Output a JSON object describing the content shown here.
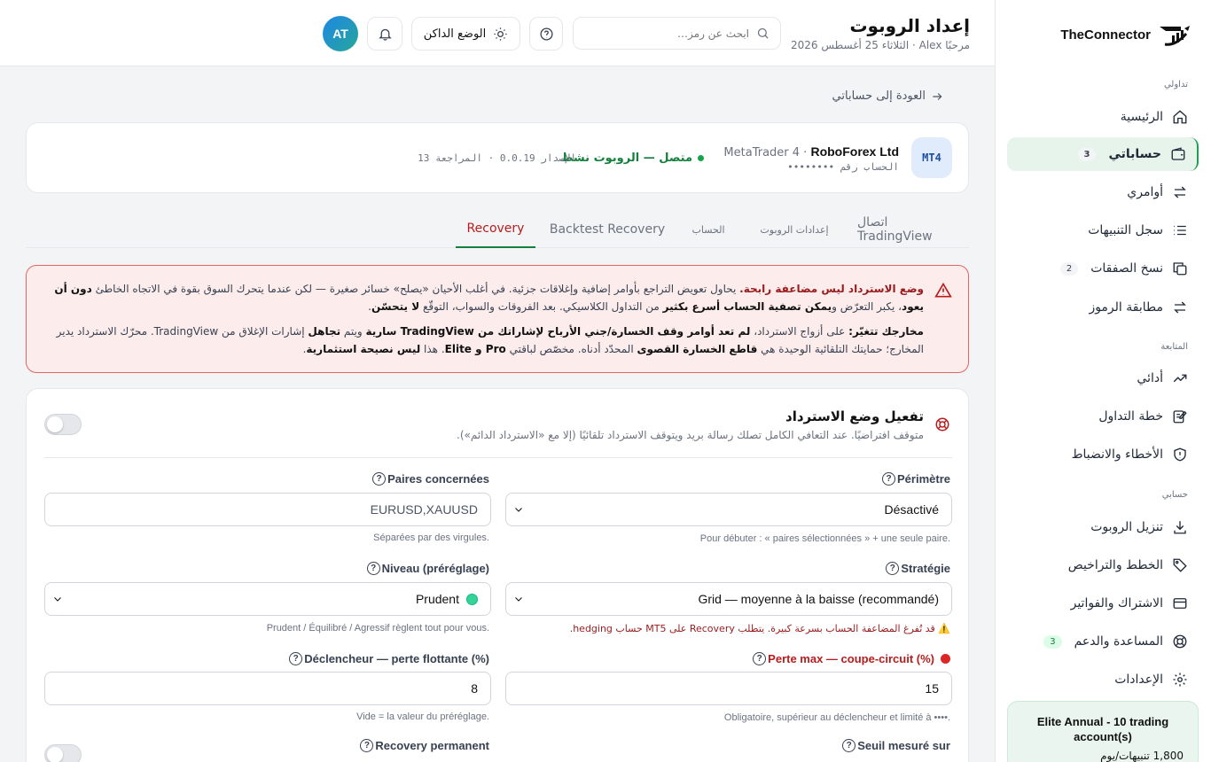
{
  "sidebar": {
    "brand": "TheConnector",
    "sections": {
      "trading": "تداولي",
      "tracking": "المتابعة",
      "account": "حسابي"
    },
    "items": [
      {
        "label": "الرئيسية",
        "badge": ""
      },
      {
        "label": "حساباتي",
        "badge": "3"
      },
      {
        "label": "أوامري",
        "badge": ""
      },
      {
        "label": "سجل التنبيهات",
        "badge": ""
      },
      {
        "label": "نسخ الصفقات",
        "badge": "2"
      },
      {
        "label": "مطابقة الرموز",
        "badge": ""
      },
      {
        "label": "أدائي",
        "badge": ""
      },
      {
        "label": "خطة التداول",
        "badge": ""
      },
      {
        "label": "الأخطاء والانضباط",
        "badge": ""
      },
      {
        "label": "تنزيل الروبوت",
        "badge": ""
      },
      {
        "label": "الخطط والتراخيص",
        "badge": ""
      },
      {
        "label": "الاشتراك والفواتير",
        "badge": ""
      },
      {
        "label": "المساعدة والدعم",
        "badge": "3"
      },
      {
        "label": "الإعدادات",
        "badge": ""
      }
    ],
    "plan": {
      "title": "Elite Annual - 10 trading account(s)",
      "sub": "1,800 تنبيهات/يوم"
    }
  },
  "header": {
    "title": "إعداد الروبوت",
    "subtitle": "مرحبًا Alex · الثلاثاء 25 أغسطس 2026",
    "search_placeholder": "ابحث عن رمز…",
    "dark_mode": "الوضع الداكن",
    "avatar": "AT"
  },
  "back_link": "العودة إلى حساباتي",
  "account": {
    "platform_badge": "MT4",
    "platform": "MetaTrader 4 ·",
    "broker": "RoboForex Ltd",
    "number": "الحساب رقم ••••••••",
    "status": "متصل — الروبوت نشط",
    "version": "الإصدار 0.0.19 · المراجعة 13"
  },
  "tabs": [
    "اتصال TradingView",
    "إعدادات الروبوت",
    "الحساب",
    "Backtest Recovery",
    "Recovery"
  ],
  "alert": {
    "p1_b1": "وضع الاسترداد ليس مضاعفة رابحة.",
    "p1_t1": " يحاول تعويض التراجع بأوامر إضافية وإغلاقات جزئية. في أغلب الأحيان «يصلح» خسائر صغيرة — لكن عندما يتحرك السوق بقوة في الاتجاه الخاطئ ",
    "p1_b2": "دون أن يعود",
    "p1_t2": "، يكبر التعرّض و",
    "p1_b3": "يمكن تصفية الحساب أسرع بكثير",
    "p1_t3": " من التداول الكلاسيكي. بعد الفروقات والسواب، التوقّع ",
    "p1_b4": "لا يتحسّن",
    "p1_t4": ".",
    "p2_b1": "مخارجك تتغيّر:",
    "p2_t1": " على أزواج الاسترداد، ",
    "p2_b2": "لم تعد أوامر وقف الخسارة/جني الأرباح لإشاراتك من TradingView سارية",
    "p2_t2": " ويتم ",
    "p2_b3": "تجاهل",
    "p2_t3": " إشارات الإغلاق من TradingView. محرّك الاسترداد يدير المخارج؛ حمايتك التلقائية الوحيدة هي ",
    "p2_b4": "قاطع الخسارة القصوى",
    "p2_t4": " المحدّد أدناه. مخصّص لباقتي ",
    "p2_b5": "Pro و Elite",
    "p2_t5": ". هذا ",
    "p2_b6": "ليس نصيحة استثمارية",
    "p2_t6": "."
  },
  "form": {
    "enable_title": "تفعيل وضع الاسترداد",
    "enable_sub": "متوقف افتراضيًا. عند التعافي الكامل تصلك رسالة بريد ويتوقف الاسترداد تلقائيًا (إلا مع «الاسترداد الدائم»).",
    "enabled": false,
    "perimetre": {
      "label": "Périmètre",
      "value": "Désactivé",
      "help": "Pour débuter : « paires sélectionnées » + une seule paire."
    },
    "paires": {
      "label": "Paires concernées",
      "placeholder": "EURUSD,XAUUSD",
      "help": "Séparées par des virgules."
    },
    "strategie": {
      "label": "Stratégie",
      "value": "Grid — moyenne à la baisse (recommandé)",
      "help": "قد تُفرغ المضاعفة الحساب بسرعة كبيرة. يتطلب Recovery على MT5 حساب hedging."
    },
    "niveau": {
      "label": "Niveau (préréglage)",
      "value": "Prudent",
      "help": "Prudent / Équilibré / Agressif règlent tout pour vous."
    },
    "perte_max": {
      "label": "Perte max — coupe-circuit (%)",
      "value": "15",
      "help": "Obligatoire, supérieur au déclencheur et limité à ••••."
    },
    "declencheur": {
      "label": "Déclencheur — perte flottante (%)",
      "value": "8",
      "help": "Vide = la valeur du préréglage."
    },
    "seuil": {
      "label": "Seuil mesuré sur"
    },
    "permanent": {
      "label": "Recovery permanent",
      "enabled": false
    }
  },
  "colors": {
    "accent": "#15803d",
    "danger": "#b91c1c",
    "alert_bg": "#fdecec"
  }
}
